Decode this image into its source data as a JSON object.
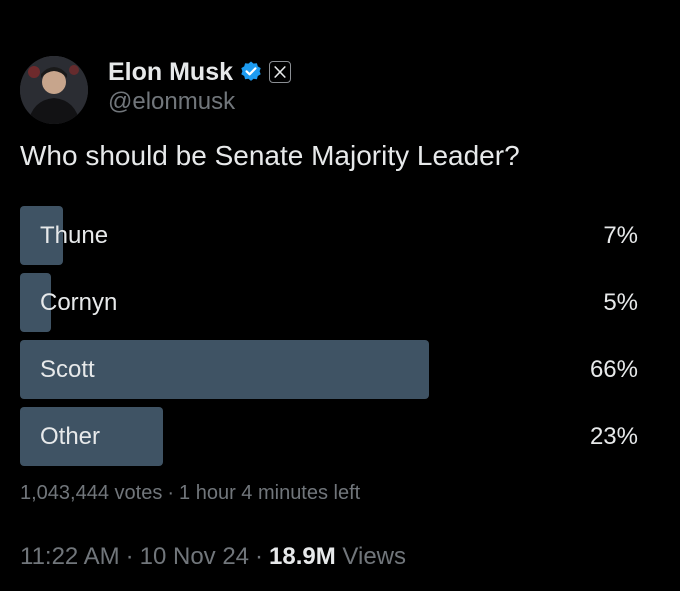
{
  "author": {
    "display_name": "Elon Musk",
    "handle": "@elonmusk",
    "verified_badge_color": "#1d9bf0",
    "icons": [
      "verified-badge-icon",
      "x-logo-icon"
    ]
  },
  "post": {
    "text": "Who should be Senate Majority Leader?"
  },
  "poll": {
    "options": [
      {
        "label": "Thune",
        "percent": "7%",
        "share": 0.07
      },
      {
        "label": "Cornyn",
        "percent": "5%",
        "share": 0.05
      },
      {
        "label": "Scott",
        "percent": "66%",
        "share": 0.66
      },
      {
        "label": "Other",
        "percent": "23%",
        "share": 0.23
      }
    ],
    "votes": "1,043,444 votes",
    "separator": "·",
    "time_left": "1 hour 4 minutes left",
    "bar_color": "#3f5364"
  },
  "meta": {
    "time": "11:22 AM",
    "date": "10 Nov 24",
    "separator": "·",
    "views_count": "18.9M",
    "views_label": "Views"
  }
}
